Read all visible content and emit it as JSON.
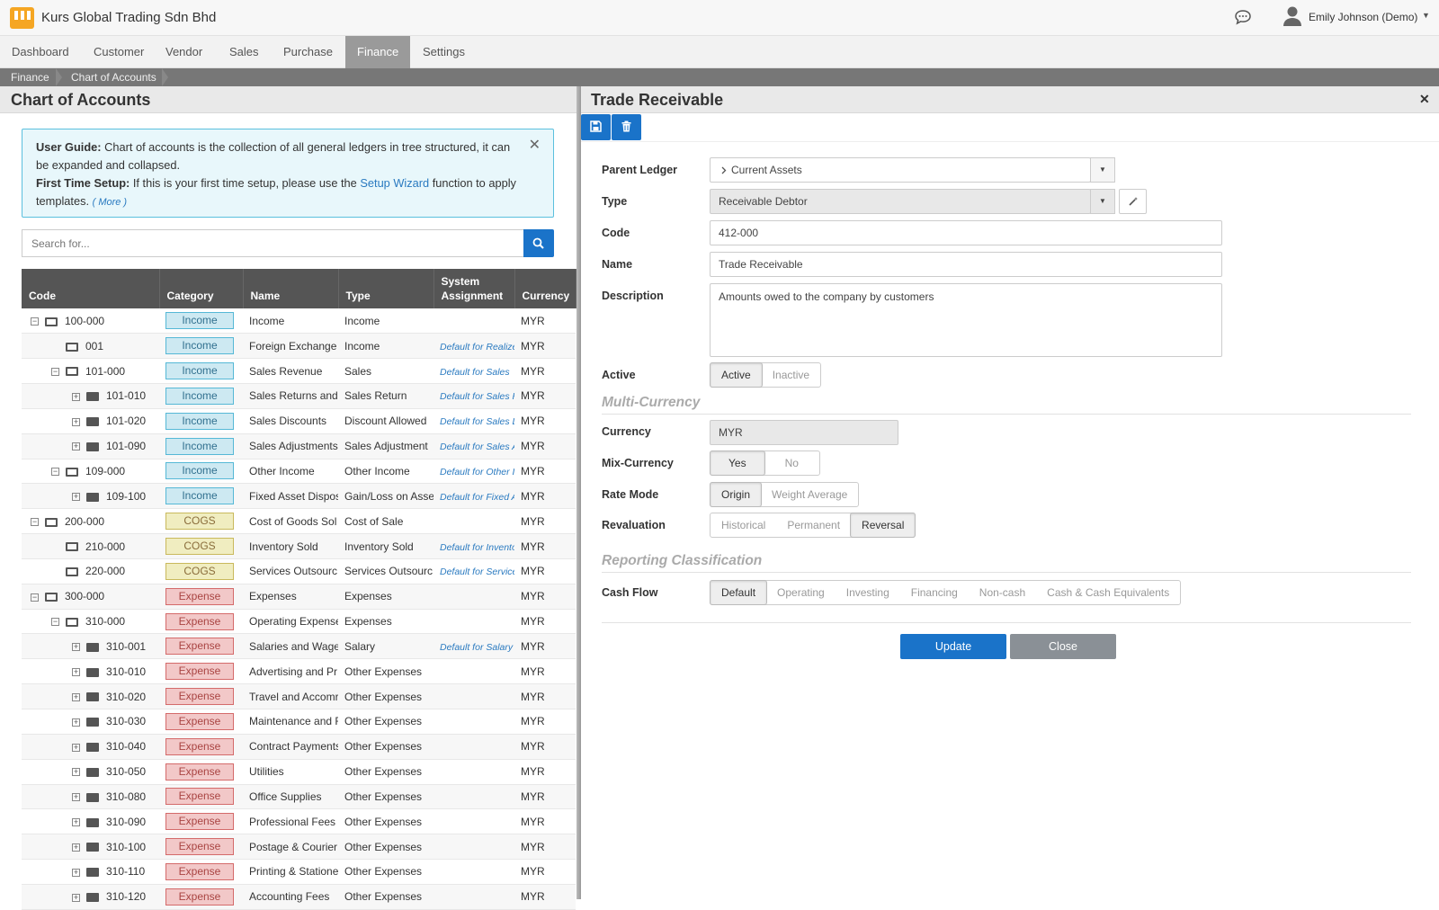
{
  "app": {
    "title": "Kurs Global Trading Sdn Bhd",
    "user": "Emily Johnson (Demo)"
  },
  "nav": [
    {
      "label": "Dashboard"
    },
    {
      "label": "Customer"
    },
    {
      "label": "Vendor"
    },
    {
      "label": "Sales"
    },
    {
      "label": "Purchase"
    },
    {
      "label": "Finance",
      "active": true
    },
    {
      "label": "Settings"
    }
  ],
  "breadcrumb": [
    "Finance",
    "Chart of Accounts"
  ],
  "left": {
    "title": "Chart of Accounts",
    "guide": {
      "label1": "User Guide:",
      "text1": " Chart of accounts is the collection of all general ledgers in tree structured, it can be expanded and collapsed.",
      "label2": "First Time Setup:",
      "text2a": " If this is your first time setup, please use the ",
      "link": "Setup Wizard",
      "text2b": " function to apply templates. ",
      "more": "( More )"
    },
    "search_placeholder": "Search for...",
    "columns": [
      "Code",
      "Category",
      "Name",
      "Type",
      "System Assignment",
      "Currency"
    ],
    "rows": [
      {
        "code": "100-000",
        "level": 0,
        "toggle": "minus",
        "folder": "open",
        "cat": "Income",
        "name": "Income",
        "type": "Income",
        "sys": "",
        "cur": "MYR"
      },
      {
        "code": "001",
        "level": 1,
        "toggle": "",
        "folder": "open",
        "cat": "Income",
        "name": "Foreign Exchange",
        "type": "Income",
        "sys": "Default for Realize",
        "cur": "MYR"
      },
      {
        "code": "101-000",
        "level": 1,
        "toggle": "minus",
        "folder": "open",
        "cat": "Income",
        "name": "Sales Revenue",
        "type": "Sales",
        "sys": "Default for Sales",
        "cur": "MYR"
      },
      {
        "code": "101-010",
        "level": 2,
        "toggle": "plus",
        "folder": "closed",
        "cat": "Income",
        "name": "Sales Returns and",
        "type": "Sales Return",
        "sys": "Default for Sales R",
        "cur": "MYR"
      },
      {
        "code": "101-020",
        "level": 2,
        "toggle": "plus",
        "folder": "closed",
        "cat": "Income",
        "name": "Sales Discounts",
        "type": "Discount Allowed",
        "sys": "Default for Sales D",
        "cur": "MYR"
      },
      {
        "code": "101-090",
        "level": 2,
        "toggle": "plus",
        "folder": "closed",
        "cat": "Income",
        "name": "Sales Adjustments",
        "type": "Sales Adjustment",
        "sys": "Default for Sales A",
        "cur": "MYR"
      },
      {
        "code": "109-000",
        "level": 1,
        "toggle": "minus",
        "folder": "open",
        "cat": "Income",
        "name": "Other Income",
        "type": "Other Income",
        "sys": "Default for Other Ir",
        "cur": "MYR"
      },
      {
        "code": "109-100",
        "level": 2,
        "toggle": "plus",
        "folder": "closed",
        "cat": "Income",
        "name": "Fixed Asset Dispos",
        "type": "Gain/Loss on Asse",
        "sys": "Default for Fixed A",
        "cur": "MYR"
      },
      {
        "code": "200-000",
        "level": 0,
        "toggle": "minus",
        "folder": "open",
        "cat": "COGS",
        "name": "Cost of Goods Sol",
        "type": "Cost of Sale",
        "sys": "",
        "cur": "MYR"
      },
      {
        "code": "210-000",
        "level": 1,
        "toggle": "",
        "folder": "open",
        "cat": "COGS",
        "name": "Inventory Sold",
        "type": "Inventory Sold",
        "sys": "Default for Invento",
        "cur": "MYR"
      },
      {
        "code": "220-000",
        "level": 1,
        "toggle": "",
        "folder": "open",
        "cat": "COGS",
        "name": "Services Outsourc",
        "type": "Services Outsourc",
        "sys": "Default for Service",
        "cur": "MYR"
      },
      {
        "code": "300-000",
        "level": 0,
        "toggle": "minus",
        "folder": "open",
        "cat": "Expense",
        "name": "Expenses",
        "type": "Expenses",
        "sys": "",
        "cur": "MYR"
      },
      {
        "code": "310-000",
        "level": 1,
        "toggle": "minus",
        "folder": "open",
        "cat": "Expense",
        "name": "Operating Expense",
        "type": "Expenses",
        "sys": "",
        "cur": "MYR"
      },
      {
        "code": "310-001",
        "level": 2,
        "toggle": "plus",
        "folder": "closed",
        "cat": "Expense",
        "name": "Salaries and Wage",
        "type": "Salary",
        "sys": "Default for Salary",
        "cur": "MYR"
      },
      {
        "code": "310-010",
        "level": 2,
        "toggle": "plus",
        "folder": "closed",
        "cat": "Expense",
        "name": "Advertising and Pr",
        "type": "Other Expenses",
        "sys": "",
        "cur": "MYR"
      },
      {
        "code": "310-020",
        "level": 2,
        "toggle": "plus",
        "folder": "closed",
        "cat": "Expense",
        "name": "Travel and Accomr",
        "type": "Other Expenses",
        "sys": "",
        "cur": "MYR"
      },
      {
        "code": "310-030",
        "level": 2,
        "toggle": "plus",
        "folder": "closed",
        "cat": "Expense",
        "name": "Maintenance and F",
        "type": "Other Expenses",
        "sys": "",
        "cur": "MYR"
      },
      {
        "code": "310-040",
        "level": 2,
        "toggle": "plus",
        "folder": "closed",
        "cat": "Expense",
        "name": "Contract Payments",
        "type": "Other Expenses",
        "sys": "",
        "cur": "MYR"
      },
      {
        "code": "310-050",
        "level": 2,
        "toggle": "plus",
        "folder": "closed",
        "cat": "Expense",
        "name": "Utilities",
        "type": "Other Expenses",
        "sys": "",
        "cur": "MYR"
      },
      {
        "code": "310-080",
        "level": 2,
        "toggle": "plus",
        "folder": "closed",
        "cat": "Expense",
        "name": "Office Supplies",
        "type": "Other Expenses",
        "sys": "",
        "cur": "MYR"
      },
      {
        "code": "310-090",
        "level": 2,
        "toggle": "plus",
        "folder": "closed",
        "cat": "Expense",
        "name": "Professional Fees",
        "type": "Other Expenses",
        "sys": "",
        "cur": "MYR"
      },
      {
        "code": "310-100",
        "level": 2,
        "toggle": "plus",
        "folder": "closed",
        "cat": "Expense",
        "name": "Postage & Courier",
        "type": "Other Expenses",
        "sys": "",
        "cur": "MYR"
      },
      {
        "code": "310-110",
        "level": 2,
        "toggle": "plus",
        "folder": "closed",
        "cat": "Expense",
        "name": "Printing & Statione",
        "type": "Other Expenses",
        "sys": "",
        "cur": "MYR"
      },
      {
        "code": "310-120",
        "level": 2,
        "toggle": "plus",
        "folder": "closed",
        "cat": "Expense",
        "name": "Accounting Fees",
        "type": "Other Expenses",
        "sys": "",
        "cur": "MYR"
      }
    ]
  },
  "form": {
    "title": "Trade Receivable",
    "labels": {
      "parent": "Parent Ledger",
      "type": "Type",
      "code": "Code",
      "name": "Name",
      "description": "Description",
      "active": "Active",
      "currency": "Currency",
      "mix": "Mix-Currency",
      "rate": "Rate Mode",
      "reval": "Revaluation",
      "cashflow": "Cash Flow"
    },
    "parent_ledger": "Current Assets",
    "type": "Receivable Debtor",
    "code": "412-000",
    "name": "Trade Receivable",
    "description": "Amounts owed to the company by customers",
    "status_options": [
      "Active",
      "Inactive"
    ],
    "status_selected": "Active",
    "section_multi": "Multi-Currency",
    "currency": "MYR",
    "mix_options": [
      "Yes",
      "No"
    ],
    "mix_selected": "Yes",
    "rate_options": [
      "Origin",
      "Weight Average"
    ],
    "rate_selected": "Origin",
    "reval_options": [
      "Historical",
      "Permanent",
      "Reversal"
    ],
    "reval_selected": "Reversal",
    "section_reporting": "Reporting Classification",
    "cashflow_options": [
      "Default",
      "Operating",
      "Investing",
      "Financing",
      "Non-cash",
      "Cash & Cash Equivalents"
    ],
    "cashflow_selected": "Default",
    "update_label": "Update",
    "close_label": "Close"
  },
  "colors": {
    "primary": "#1a73c9",
    "close_btn": "#8a9096",
    "income": "#cde9f2",
    "cogs": "#f0edc0",
    "expense": "#f2c8c8"
  }
}
